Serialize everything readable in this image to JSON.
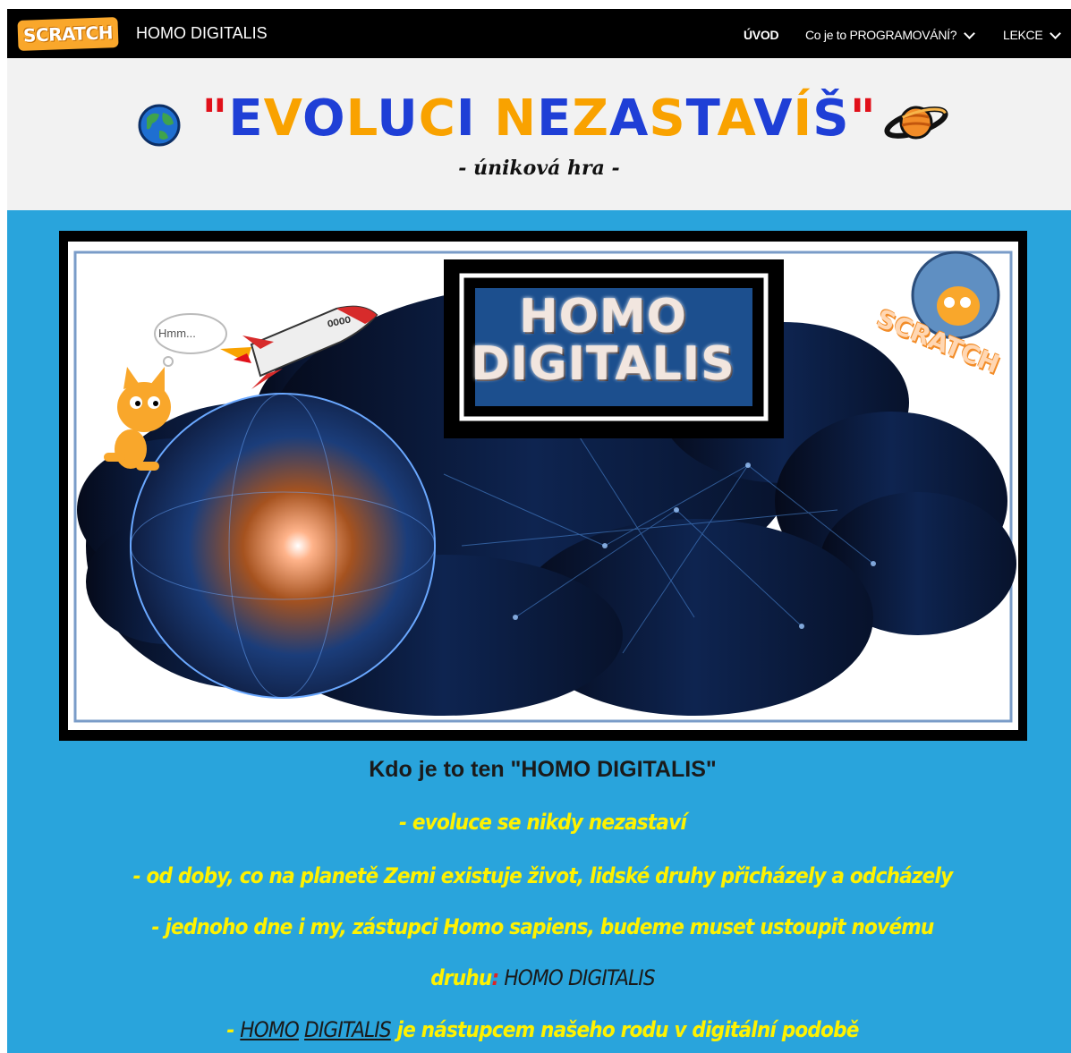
{
  "nav": {
    "logo": "SCRATCH",
    "site_title": "HOMO DIGITALIS",
    "items": [
      {
        "label": "ÚVOD",
        "active": true
      },
      {
        "label": "Co je to PROGRAMOVÁNÍ?",
        "active": false
      },
      {
        "label": "LEKCE",
        "active": false
      }
    ]
  },
  "hero": {
    "title_quote_open": "\"",
    "title_letters": [
      {
        "ch": "E",
        "color": "#1f3fd6"
      },
      {
        "ch": "V",
        "color": "#f9a200"
      },
      {
        "ch": "O",
        "color": "#1f3fd6"
      },
      {
        "ch": "L",
        "color": "#f9a200"
      },
      {
        "ch": "U",
        "color": "#1f3fd6"
      },
      {
        "ch": "C",
        "color": "#f9a200"
      },
      {
        "ch": "I",
        "color": "#1f3fd6"
      },
      {
        "ch": " ",
        "color": "#1f3fd6"
      },
      {
        "ch": "N",
        "color": "#f9a200"
      },
      {
        "ch": "E",
        "color": "#1f3fd6"
      },
      {
        "ch": "Z",
        "color": "#f9a200"
      },
      {
        "ch": "A",
        "color": "#1f3fd6"
      },
      {
        "ch": "S",
        "color": "#f9a200"
      },
      {
        "ch": "T",
        "color": "#1f3fd6"
      },
      {
        "ch": "A",
        "color": "#f9a200"
      },
      {
        "ch": "V",
        "color": "#1f3fd6"
      },
      {
        "ch": "Í",
        "color": "#f9a200"
      },
      {
        "ch": "Š",
        "color": "#1f3fd6"
      }
    ],
    "title_quote_close": "\"",
    "subtitle": "- úniková hra -",
    "icons": [
      "globe-icon",
      "planet-icon"
    ]
  },
  "banner": {
    "title_line1": "HOMO",
    "title_line2": "DIGITALIS",
    "bubble": "Hmm...",
    "rocket_label": "OOOO",
    "badge": "SCRATCH"
  },
  "content": {
    "heading": "Kdo je to ten \"HOMO DIGITALIS\"",
    "line1": "- evoluce se nikdy nezastaví",
    "line2": "- od doby, co na planetě Zemi existuje život,  lidské druhy přicházely a odcházely",
    "line3": "-  jednoho dne i my, zástupci Homo sapiens, budeme muset ustoupit novému",
    "line4a": "druhu",
    "line4b": ":",
    "line4c": " HOMO DIGITALIS",
    "line5a": "- ",
    "line5b": "HOMO",
    "line5c": " ",
    "line5d": "DIGITALIS",
    "line5e": " je nástupcem našeho rodu v digitální podobě"
  },
  "colors": {
    "page_bg": "#29a4dc",
    "nav_bg": "#000000",
    "hero_bg": "#f2f2f2",
    "text_yellow": "#fff200",
    "quote_red": "#e1101a"
  }
}
